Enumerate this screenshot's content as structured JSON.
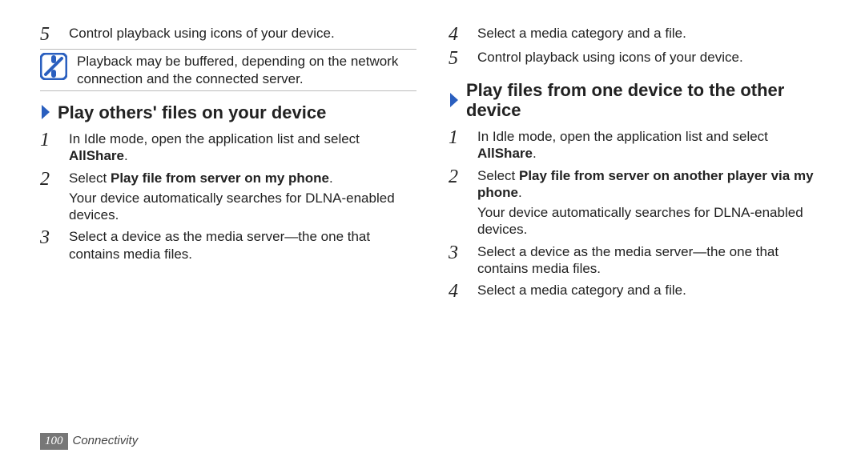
{
  "left": {
    "step5": "Control playback using icons of your device.",
    "note": "Playback may be buffered, depending on the network connection and the connected server.",
    "sectionA": {
      "title": "Play others' files on your device",
      "s1a": "In Idle mode, open the application list and select ",
      "s1b": "AllShare",
      "s1c": ".",
      "s2a": "Select ",
      "s2b": "Play file from server on my phone",
      "s2c": ".",
      "s2d": "Your device automatically searches for DLNA-enabled devices.",
      "s3": "Select a device as the media server—the one that contains media files."
    }
  },
  "right": {
    "step4": "Select a media category and a file.",
    "step5": "Control playback using icons of your device.",
    "sectionB": {
      "title": "Play files from one device to the other device",
      "s1a": "In Idle mode, open the application list and select ",
      "s1b": "AllShare",
      "s1c": ".",
      "s2a": "Select ",
      "s2b": "Play file from server on another player via my phone",
      "s2c": ".",
      "s2d": "Your device automatically searches for DLNA-enabled devices.",
      "s3": "Select a device as the media server—the one that contains media files.",
      "s4": "Select a media category and a file."
    }
  },
  "footer": {
    "page": "100",
    "section": "Connectivity"
  },
  "nums": {
    "n1": "1",
    "n2": "2",
    "n3": "3",
    "n4": "4",
    "n5": "5"
  }
}
